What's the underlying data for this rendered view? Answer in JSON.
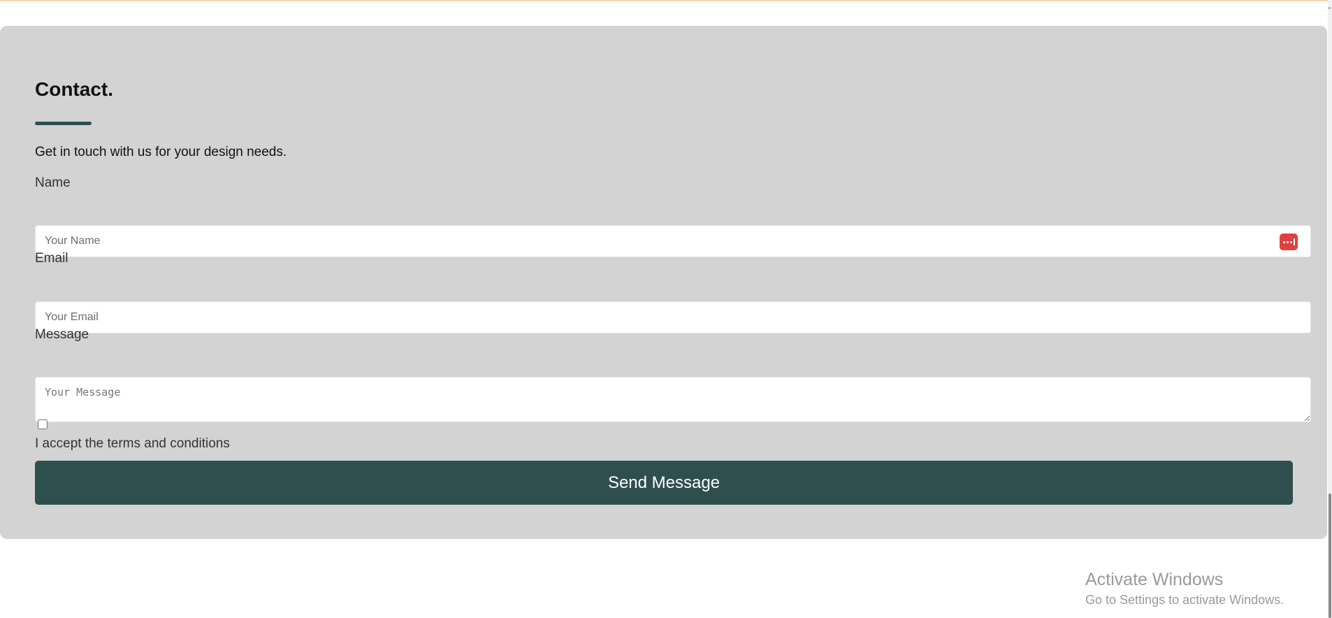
{
  "contact": {
    "title": "Contact.",
    "subtitle": "Get in touch with us for your design needs.",
    "name_label": "Name",
    "name_placeholder": "Your Name",
    "name_value": "",
    "email_label": "Email",
    "email_placeholder": "Your Email",
    "email_value": "",
    "message_label": "Message",
    "message_placeholder": "Your Message",
    "message_value": "",
    "terms_label": "I accept the terms and conditions",
    "terms_checked": false,
    "send_label": "Send Message"
  },
  "watermark": {
    "title": "Activate Windows",
    "subtitle": "Go to Settings to activate Windows."
  },
  "icons": {
    "password_manager": "password-manager-icon"
  },
  "colors": {
    "card_background": "#d3d3d3",
    "accent": "#2f4f4f",
    "icon_red": "#e0413f",
    "top_rule": "#f3d6b3"
  }
}
